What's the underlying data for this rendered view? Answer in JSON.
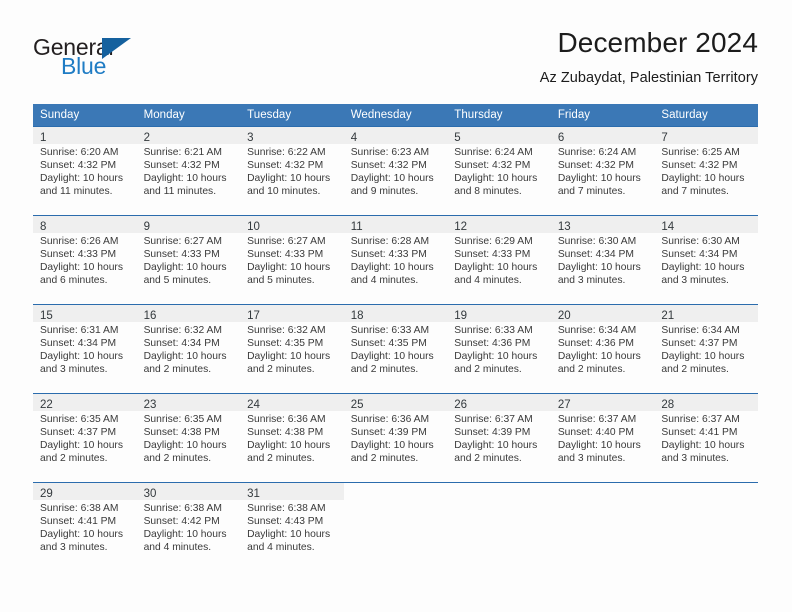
{
  "brand": {
    "word1": "General",
    "word2": "Blue",
    "triangle_color": "#15619e",
    "blue_color": "#1f7cc4"
  },
  "header": {
    "title": "December 2024",
    "subtitle": "Az Zubaydat, Palestinian Territory"
  },
  "theme": {
    "header_row_bg": "#3b78b6",
    "header_row_text": "#ffffff",
    "daynum_bar_bg": "#efefef",
    "row_divider": "#2b6cad"
  },
  "weekday_headers": [
    "Sunday",
    "Monday",
    "Tuesday",
    "Wednesday",
    "Thursday",
    "Friday",
    "Saturday"
  ],
  "weeks": [
    [
      {
        "day": "1",
        "sunrise": "Sunrise: 6:20 AM",
        "sunset": "Sunset: 4:32 PM",
        "daylight1": "Daylight: 10 hours",
        "daylight2": "and 11 minutes."
      },
      {
        "day": "2",
        "sunrise": "Sunrise: 6:21 AM",
        "sunset": "Sunset: 4:32 PM",
        "daylight1": "Daylight: 10 hours",
        "daylight2": "and 11 minutes."
      },
      {
        "day": "3",
        "sunrise": "Sunrise: 6:22 AM",
        "sunset": "Sunset: 4:32 PM",
        "daylight1": "Daylight: 10 hours",
        "daylight2": "and 10 minutes."
      },
      {
        "day": "4",
        "sunrise": "Sunrise: 6:23 AM",
        "sunset": "Sunset: 4:32 PM",
        "daylight1": "Daylight: 10 hours",
        "daylight2": "and 9 minutes."
      },
      {
        "day": "5",
        "sunrise": "Sunrise: 6:24 AM",
        "sunset": "Sunset: 4:32 PM",
        "daylight1": "Daylight: 10 hours",
        "daylight2": "and 8 minutes."
      },
      {
        "day": "6",
        "sunrise": "Sunrise: 6:24 AM",
        "sunset": "Sunset: 4:32 PM",
        "daylight1": "Daylight: 10 hours",
        "daylight2": "and 7 minutes."
      },
      {
        "day": "7",
        "sunrise": "Sunrise: 6:25 AM",
        "sunset": "Sunset: 4:32 PM",
        "daylight1": "Daylight: 10 hours",
        "daylight2": "and 7 minutes."
      }
    ],
    [
      {
        "day": "8",
        "sunrise": "Sunrise: 6:26 AM",
        "sunset": "Sunset: 4:33 PM",
        "daylight1": "Daylight: 10 hours",
        "daylight2": "and 6 minutes."
      },
      {
        "day": "9",
        "sunrise": "Sunrise: 6:27 AM",
        "sunset": "Sunset: 4:33 PM",
        "daylight1": "Daylight: 10 hours",
        "daylight2": "and 5 minutes."
      },
      {
        "day": "10",
        "sunrise": "Sunrise: 6:27 AM",
        "sunset": "Sunset: 4:33 PM",
        "daylight1": "Daylight: 10 hours",
        "daylight2": "and 5 minutes."
      },
      {
        "day": "11",
        "sunrise": "Sunrise: 6:28 AM",
        "sunset": "Sunset: 4:33 PM",
        "daylight1": "Daylight: 10 hours",
        "daylight2": "and 4 minutes."
      },
      {
        "day": "12",
        "sunrise": "Sunrise: 6:29 AM",
        "sunset": "Sunset: 4:33 PM",
        "daylight1": "Daylight: 10 hours",
        "daylight2": "and 4 minutes."
      },
      {
        "day": "13",
        "sunrise": "Sunrise: 6:30 AM",
        "sunset": "Sunset: 4:34 PM",
        "daylight1": "Daylight: 10 hours",
        "daylight2": "and 3 minutes."
      },
      {
        "day": "14",
        "sunrise": "Sunrise: 6:30 AM",
        "sunset": "Sunset: 4:34 PM",
        "daylight1": "Daylight: 10 hours",
        "daylight2": "and 3 minutes."
      }
    ],
    [
      {
        "day": "15",
        "sunrise": "Sunrise: 6:31 AM",
        "sunset": "Sunset: 4:34 PM",
        "daylight1": "Daylight: 10 hours",
        "daylight2": "and 3 minutes."
      },
      {
        "day": "16",
        "sunrise": "Sunrise: 6:32 AM",
        "sunset": "Sunset: 4:34 PM",
        "daylight1": "Daylight: 10 hours",
        "daylight2": "and 2 minutes."
      },
      {
        "day": "17",
        "sunrise": "Sunrise: 6:32 AM",
        "sunset": "Sunset: 4:35 PM",
        "daylight1": "Daylight: 10 hours",
        "daylight2": "and 2 minutes."
      },
      {
        "day": "18",
        "sunrise": "Sunrise: 6:33 AM",
        "sunset": "Sunset: 4:35 PM",
        "daylight1": "Daylight: 10 hours",
        "daylight2": "and 2 minutes."
      },
      {
        "day": "19",
        "sunrise": "Sunrise: 6:33 AM",
        "sunset": "Sunset: 4:36 PM",
        "daylight1": "Daylight: 10 hours",
        "daylight2": "and 2 minutes."
      },
      {
        "day": "20",
        "sunrise": "Sunrise: 6:34 AM",
        "sunset": "Sunset: 4:36 PM",
        "daylight1": "Daylight: 10 hours",
        "daylight2": "and 2 minutes."
      },
      {
        "day": "21",
        "sunrise": "Sunrise: 6:34 AM",
        "sunset": "Sunset: 4:37 PM",
        "daylight1": "Daylight: 10 hours",
        "daylight2": "and 2 minutes."
      }
    ],
    [
      {
        "day": "22",
        "sunrise": "Sunrise: 6:35 AM",
        "sunset": "Sunset: 4:37 PM",
        "daylight1": "Daylight: 10 hours",
        "daylight2": "and 2 minutes."
      },
      {
        "day": "23",
        "sunrise": "Sunrise: 6:35 AM",
        "sunset": "Sunset: 4:38 PM",
        "daylight1": "Daylight: 10 hours",
        "daylight2": "and 2 minutes."
      },
      {
        "day": "24",
        "sunrise": "Sunrise: 6:36 AM",
        "sunset": "Sunset: 4:38 PM",
        "daylight1": "Daylight: 10 hours",
        "daylight2": "and 2 minutes."
      },
      {
        "day": "25",
        "sunrise": "Sunrise: 6:36 AM",
        "sunset": "Sunset: 4:39 PM",
        "daylight1": "Daylight: 10 hours",
        "daylight2": "and 2 minutes."
      },
      {
        "day": "26",
        "sunrise": "Sunrise: 6:37 AM",
        "sunset": "Sunset: 4:39 PM",
        "daylight1": "Daylight: 10 hours",
        "daylight2": "and 2 minutes."
      },
      {
        "day": "27",
        "sunrise": "Sunrise: 6:37 AM",
        "sunset": "Sunset: 4:40 PM",
        "daylight1": "Daylight: 10 hours",
        "daylight2": "and 3 minutes."
      },
      {
        "day": "28",
        "sunrise": "Sunrise: 6:37 AM",
        "sunset": "Sunset: 4:41 PM",
        "daylight1": "Daylight: 10 hours",
        "daylight2": "and 3 minutes."
      }
    ],
    [
      {
        "day": "29",
        "sunrise": "Sunrise: 6:38 AM",
        "sunset": "Sunset: 4:41 PM",
        "daylight1": "Daylight: 10 hours",
        "daylight2": "and 3 minutes."
      },
      {
        "day": "30",
        "sunrise": "Sunrise: 6:38 AM",
        "sunset": "Sunset: 4:42 PM",
        "daylight1": "Daylight: 10 hours",
        "daylight2": "and 4 minutes."
      },
      {
        "day": "31",
        "sunrise": "Sunrise: 6:38 AM",
        "sunset": "Sunset: 4:43 PM",
        "daylight1": "Daylight: 10 hours",
        "daylight2": "and 4 minutes."
      },
      {
        "day": "",
        "sunrise": "",
        "sunset": "",
        "daylight1": "",
        "daylight2": ""
      },
      {
        "day": "",
        "sunrise": "",
        "sunset": "",
        "daylight1": "",
        "daylight2": ""
      },
      {
        "day": "",
        "sunrise": "",
        "sunset": "",
        "daylight1": "",
        "daylight2": ""
      },
      {
        "day": "",
        "sunrise": "",
        "sunset": "",
        "daylight1": "",
        "daylight2": ""
      }
    ]
  ]
}
